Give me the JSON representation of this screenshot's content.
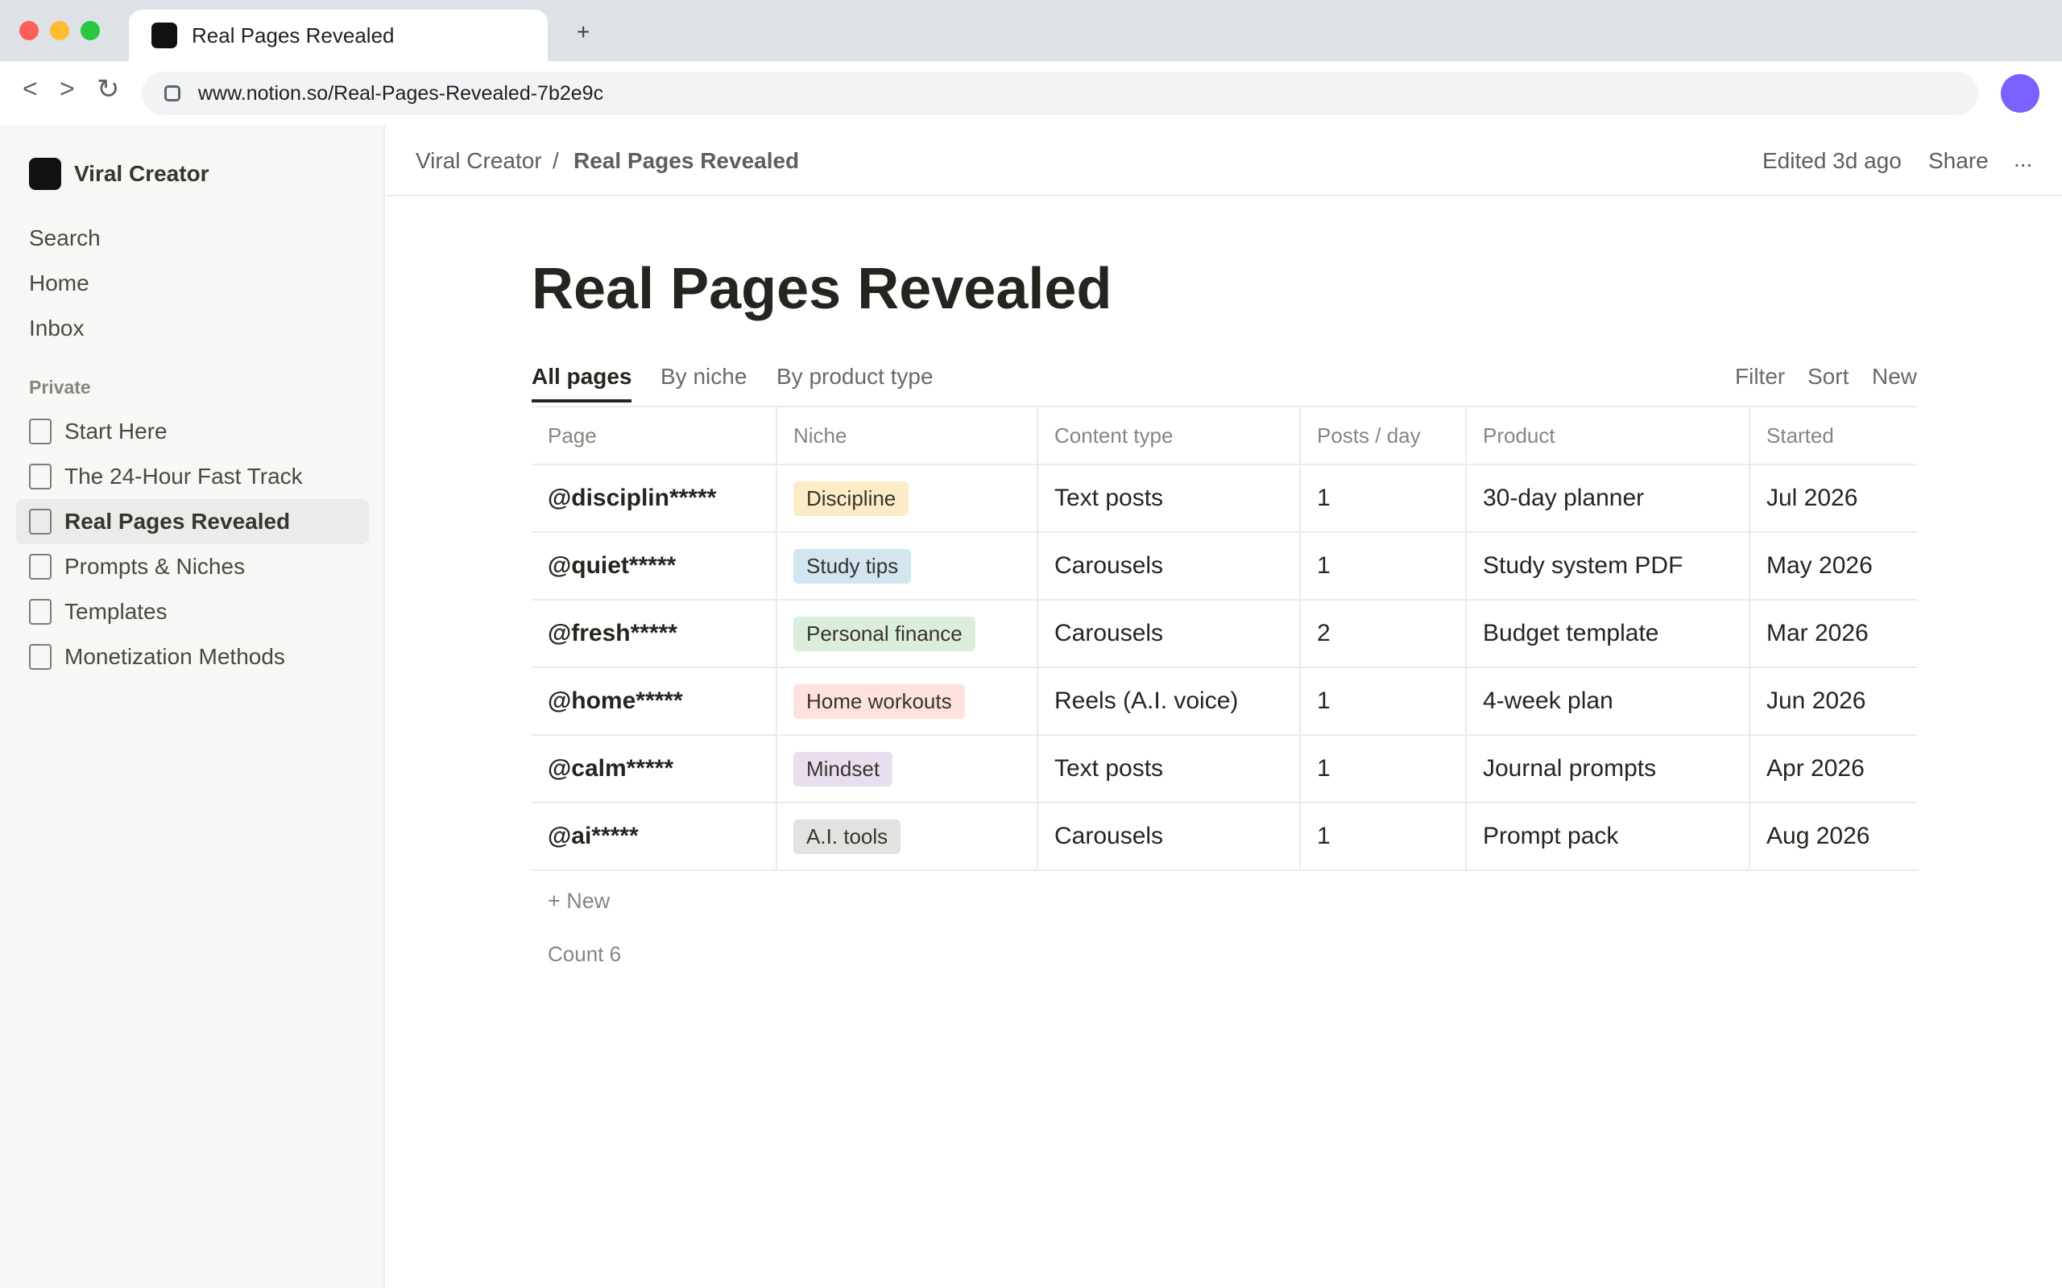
{
  "browser": {
    "tab_title": "Real Pages Revealed",
    "new_tab": "+",
    "back": "<",
    "forward": ">",
    "reload": "↻",
    "url": "www.notion.so/Real-Pages-Revealed-7b2e9c",
    "icons": [
      "site-info-icon",
      "tab-favicon",
      "profile-avatar"
    ],
    "avatar_color": "#7b61ff"
  },
  "sidebar": {
    "workspace_name": "Viral Creator",
    "nav": [
      {
        "label": "Search"
      },
      {
        "label": "Home"
      },
      {
        "label": "Inbox"
      }
    ],
    "section_label": "Private",
    "pages": [
      {
        "label": "Start Here",
        "active": false
      },
      {
        "label": "The 24-Hour Fast Track",
        "active": false
      },
      {
        "label": "Real Pages Revealed",
        "active": true
      },
      {
        "label": "Prompts & Niches",
        "active": false
      },
      {
        "label": "Templates",
        "active": false
      },
      {
        "label": "Monetization Methods",
        "active": false
      }
    ]
  },
  "header": {
    "breadcrumb_root": "Viral Creator",
    "breadcrumb_sep": "/",
    "breadcrumb_current": "Real Pages Revealed",
    "edited": "Edited 3d ago",
    "share": "Share",
    "more": "..."
  },
  "page": {
    "title": "Real Pages Revealed",
    "views": [
      {
        "label": "All pages",
        "active": true
      },
      {
        "label": "By niche",
        "active": false
      },
      {
        "label": "By product type",
        "active": false
      }
    ],
    "actions": {
      "filter": "Filter",
      "sort": "Sort",
      "new": "New"
    },
    "table": {
      "columns": [
        "Page",
        "Niche",
        "Content type",
        "Posts / day",
        "Product",
        "Started"
      ],
      "rows": [
        {
          "page": "@disciplin*****",
          "niche": "Discipline",
          "niche_color": "#fbecc7",
          "content_type": "Text posts",
          "posts_per_day": "1",
          "product": "30-day planner",
          "started": "Jul 2026"
        },
        {
          "page": "@quiet*****",
          "niche": "Study tips",
          "niche_color": "#d3e5ef",
          "content_type": "Carousels",
          "posts_per_day": "1",
          "product": "Study system PDF",
          "started": "May 2026"
        },
        {
          "page": "@fresh*****",
          "niche": "Personal finance",
          "niche_color": "#dbeddb",
          "content_type": "Carousels",
          "posts_per_day": "2",
          "product": "Budget template",
          "started": "Mar 2026"
        },
        {
          "page": "@home*****",
          "niche": "Home workouts",
          "niche_color": "#ffe2dd",
          "content_type": "Reels (A.I. voice)",
          "posts_per_day": "1",
          "product": "4-week plan",
          "started": "Jun 2026"
        },
        {
          "page": "@calm*****",
          "niche": "Mindset",
          "niche_color": "#e8deee",
          "content_type": "Text posts",
          "posts_per_day": "1",
          "product": "Journal prompts",
          "started": "Apr 2026"
        },
        {
          "page": "@ai*****",
          "niche": "A.I. tools",
          "niche_color": "#e3e2e0",
          "content_type": "Carousels",
          "posts_per_day": "1",
          "product": "Prompt pack",
          "started": "Aug 2026"
        }
      ]
    },
    "new_row": "+ New",
    "count": "Count 6"
  }
}
